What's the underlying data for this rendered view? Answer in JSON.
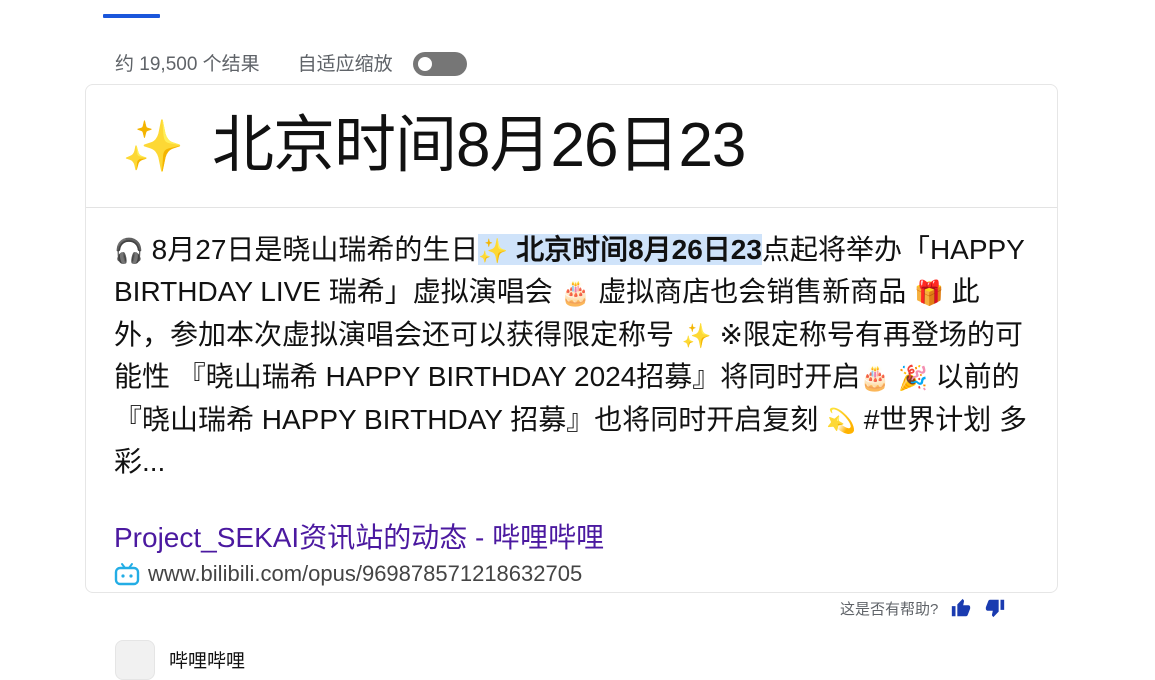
{
  "search_meta": {
    "result_count": "约 19,500 个结果",
    "adaptive_zoom_label": "自适应缩放",
    "adaptive_zoom_enabled": false
  },
  "answer_card": {
    "headline_icon": "sparkles-emoji",
    "headline": "北京时间8月26日23",
    "snippet": {
      "p1": "8月27日是晓山瑞希的生日",
      "highlight_icon": "✨",
      "highlight_bold": "北京时间8月26日23",
      "p2": "点起将举办「HAPPY BIRTHDAY LIVE 瑞希」虚拟演唱会",
      "p3": " 虚拟商店也会销售新商品",
      "p4": " 此外，参加本次虚拟演唱会还可以获得限定称号",
      "p5": " ※限定称号有再登场的可能性 『晓山瑞希 HAPPY BIRTHDAY 2024招募』将同时开启",
      "p6": " 以前的『晓山瑞希 HAPPY BIRTHDAY 招募』也将同时开启复刻",
      "p7": " #世界计划 多彩..."
    },
    "source_title": "Project_SEKAI资讯站的动态 - 哔哩哔哩",
    "source_url": "www.bilibili.com/opus/969878571218632705",
    "source_icon": "bilibili-tv-icon"
  },
  "feedback": {
    "question": "这是否有帮助?",
    "thumbs_up_icon": "thumbs-up-icon",
    "thumbs_down_icon": "thumbs-down-icon"
  },
  "next_result": {
    "site_name": "哔哩哔哩"
  },
  "colors": {
    "accent": "#1a56db",
    "link_visited": "#4b19a0",
    "highlight": "#cfe3fa",
    "thumb_icons": "#1a3bb0"
  }
}
